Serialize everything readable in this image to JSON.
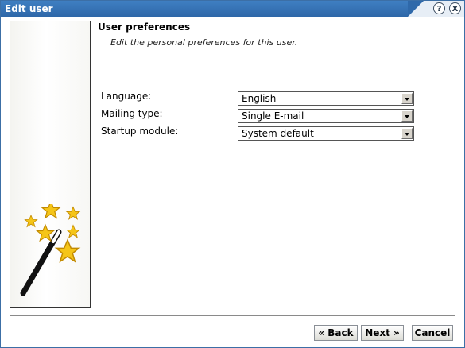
{
  "window": {
    "title": "Edit user",
    "help_glyph": "?",
    "close_glyph": "X"
  },
  "sidepanel": {
    "illustration": "magic-wand-with-stars-icon"
  },
  "main": {
    "heading": "User preferences",
    "subheading": "Edit the personal preferences for this user.",
    "fields": [
      {
        "label": "Language:",
        "value": "English"
      },
      {
        "label": "Mailing type:",
        "value": "Single E-mail"
      },
      {
        "label": "Startup module:",
        "value": "System default"
      }
    ]
  },
  "footer": {
    "back_label": "« Back",
    "next_label": "Next »",
    "cancel_label": "Cancel"
  },
  "colors": {
    "titlebar": "#3f7fc2",
    "star": "#f5c518"
  }
}
